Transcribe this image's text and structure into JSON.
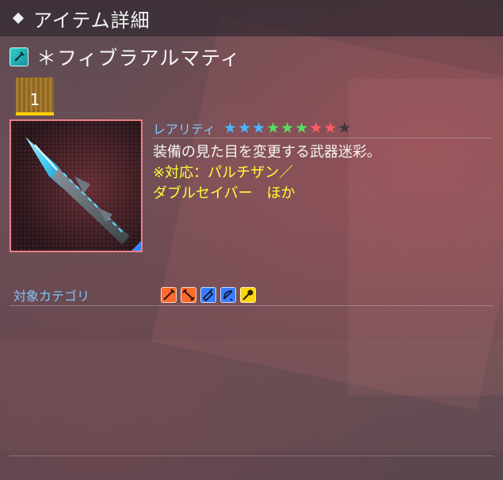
{
  "header": {
    "title": "アイテム詳細"
  },
  "item": {
    "name": "＊フィブラアルマティ",
    "count": "1",
    "icon": "weapon-camo-icon"
  },
  "rarity": {
    "label": "レアリティ",
    "stars": [
      {
        "color": "#4db6ff",
        "filled": true
      },
      {
        "color": "#4db6ff",
        "filled": true
      },
      {
        "color": "#4db6ff",
        "filled": true
      },
      {
        "color": "#58dd62",
        "filled": true
      },
      {
        "color": "#58dd62",
        "filled": true
      },
      {
        "color": "#58dd62",
        "filled": true
      },
      {
        "color": "#ff5b63",
        "filled": true
      },
      {
        "color": "#ff5b63",
        "filled": true
      },
      {
        "color": "#3a3a3f",
        "filled": false
      }
    ]
  },
  "description": {
    "line1": "装備の見た目を変更する武器迷彩。",
    "line2": "※対応：パルチザン／",
    "line3": "ダブルセイバー　ほか"
  },
  "category": {
    "label": "対象カテゴリ",
    "icons": [
      {
        "name": "partisan-icon",
        "bg": "#ff6a2e"
      },
      {
        "name": "double-saber-icon",
        "bg": "#ff6a2e"
      },
      {
        "name": "launcher-icon",
        "bg": "#3a7cff"
      },
      {
        "name": "bow-icon",
        "bg": "#3a7cff"
      },
      {
        "name": "wand-icon",
        "bg": "#ffd60a"
      }
    ]
  }
}
